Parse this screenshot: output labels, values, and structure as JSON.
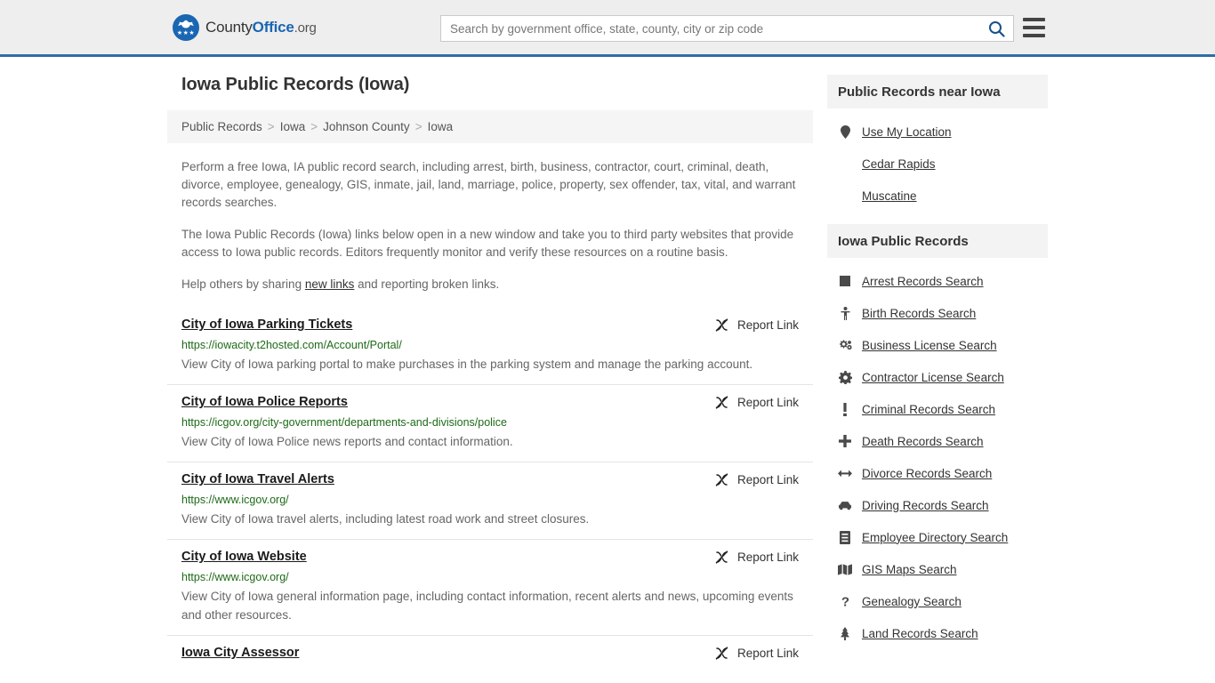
{
  "header": {
    "brand_prefix": "County",
    "brand_bold": "Office",
    "brand_suffix": ".org",
    "search_placeholder": "Search by government office, state, county, city or zip code",
    "search_value": "",
    "search_icon": "search-icon",
    "menu_icon": "hamburger-menu-icon",
    "accent_color": "#2f6ca6",
    "background_color": "#eeeeee"
  },
  "page": {
    "title": "Iowa Public Records (Iowa)"
  },
  "breadcrumb": {
    "separator": ">",
    "items": [
      {
        "label": "Public Records"
      },
      {
        "label": "Iowa"
      },
      {
        "label": "Johnson County"
      },
      {
        "label": "Iowa"
      }
    ]
  },
  "intro": {
    "paragraph1": "Perform a free Iowa, IA public record search, including arrest, birth, business, contractor, court, criminal, death, divorce, employee, genealogy, GIS, inmate, jail, land, marriage, police, property, sex offender, tax, vital, and warrant records searches.",
    "paragraph2": "The Iowa Public Records (Iowa) links below open in a new window and take you to third party websites that provide access to Iowa public records. Editors frequently monitor and verify these resources on a routine basis.",
    "paragraph3_before": "Help others by sharing ",
    "paragraph3_link": "new links",
    "paragraph3_after": " and reporting broken links."
  },
  "results": {
    "report_label": "Report Link",
    "report_icon": "broken-link-icon",
    "items": [
      {
        "title": "City of Iowa Parking Tickets",
        "url": "https://iowacity.t2hosted.com/Account/Portal/",
        "description": "View City of Iowa parking portal to make purchases in the parking system and manage the parking account."
      },
      {
        "title": "City of Iowa Police Reports",
        "url": "https://icgov.org/city-government/departments-and-divisions/police",
        "description": "View City of Iowa Police news reports and contact information."
      },
      {
        "title": "City of Iowa Travel Alerts",
        "url": "https://www.icgov.org/",
        "description": "View City of Iowa travel alerts, including latest road work and street closures."
      },
      {
        "title": "City of Iowa Website",
        "url": "https://www.icgov.org/",
        "description": "View City of Iowa general information page, including contact information, recent alerts and news, upcoming events and other resources."
      },
      {
        "title": "Iowa City Assessor",
        "url": "",
        "description": ""
      }
    ]
  },
  "sidebar": {
    "near_panel": {
      "heading": "Public Records near Iowa",
      "items": [
        {
          "label": "Use My Location",
          "icon": "map-pin-icon"
        },
        {
          "label": "Cedar Rapids",
          "icon": ""
        },
        {
          "label": "Muscatine",
          "icon": ""
        }
      ]
    },
    "records_panel": {
      "heading": "Iowa Public Records",
      "items": [
        {
          "label": "Arrest Records Search",
          "icon": "square-icon"
        },
        {
          "label": "Birth Records Search",
          "icon": "child-icon"
        },
        {
          "label": "Business License Search",
          "icon": "cogs-icon"
        },
        {
          "label": "Contractor License Search",
          "icon": "cog-icon"
        },
        {
          "label": "Criminal Records Search",
          "icon": "exclamation-icon"
        },
        {
          "label": "Death Records Search",
          "icon": "plus-icon"
        },
        {
          "label": "Divorce Records Search",
          "icon": "arrows-horizontal-icon"
        },
        {
          "label": "Driving Records Search",
          "icon": "car-icon"
        },
        {
          "label": "Employee Directory Search",
          "icon": "book-icon"
        },
        {
          "label": "GIS Maps Search",
          "icon": "map-icon"
        },
        {
          "label": "Genealogy Search",
          "icon": "question-icon"
        },
        {
          "label": "Land Records Search",
          "icon": "tree-icon"
        }
      ]
    }
  }
}
